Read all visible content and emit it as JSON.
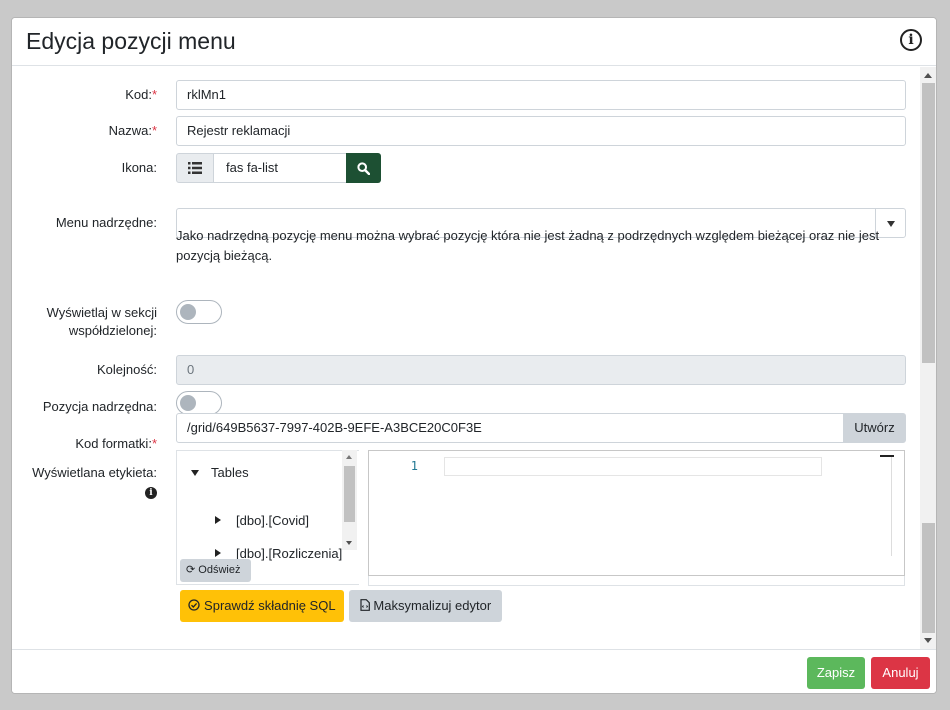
{
  "modal": {
    "title": "Edycja pozycji menu",
    "info_icon": "info-circle-icon"
  },
  "form": {
    "kod": {
      "label": "Kod:",
      "required_mark": "*",
      "value": "rklMn1"
    },
    "nazwa": {
      "label": "Nazwa:",
      "required_mark": "*",
      "value": "Rejestr reklamacji"
    },
    "ikona": {
      "label": "Ikona:",
      "value": "fas fa-list",
      "prefix_icon": "list-icon",
      "button_icon": "search-icon"
    },
    "menu_nadrzedne": {
      "label": "Menu nadrzędne:",
      "value": "",
      "hint": "Jako nadrzędną pozycję menu można wybrać pozycję która nie jest żadną z podrzędnych względem bieżącej oraz nie jest pozycją bieżącą."
    },
    "wyswietlaj": {
      "label_line1": "Wyświetlaj w sekcji",
      "label_line2": "współdzielonej:",
      "checked": false
    },
    "kolejnosc": {
      "label": "Kolejność:",
      "value": "0"
    },
    "pozycja_nadrzedna": {
      "label": "Pozycja nadrzędna:",
      "checked": false
    },
    "kod_formatki": {
      "label": "Kod formatki:",
      "required_mark": "*",
      "value": "/grid/649B5637-7997-402B-9EFE-A3BCE20C0F3E",
      "button": "Utwórz"
    },
    "etykieta": {
      "label": "Wyświetlana etykieta:",
      "info_icon": "info-circle-icon"
    }
  },
  "tree": {
    "root": "Tables",
    "items": [
      "[dbo].[Covid]",
      "[dbo].[Rozliczenia]"
    ],
    "refresh_button": "Odśwież"
  },
  "editor": {
    "line_number": "1"
  },
  "actions": {
    "check_sql": "Sprawdź składnię SQL",
    "maximize": "Maksymalizuj edytor"
  },
  "footer": {
    "save": "Zapisz",
    "cancel": "Anuluj"
  },
  "colors": {
    "save": "#5cb85c",
    "cancel": "#dc3545",
    "warning": "#ffc107",
    "search": "#1d5033"
  }
}
